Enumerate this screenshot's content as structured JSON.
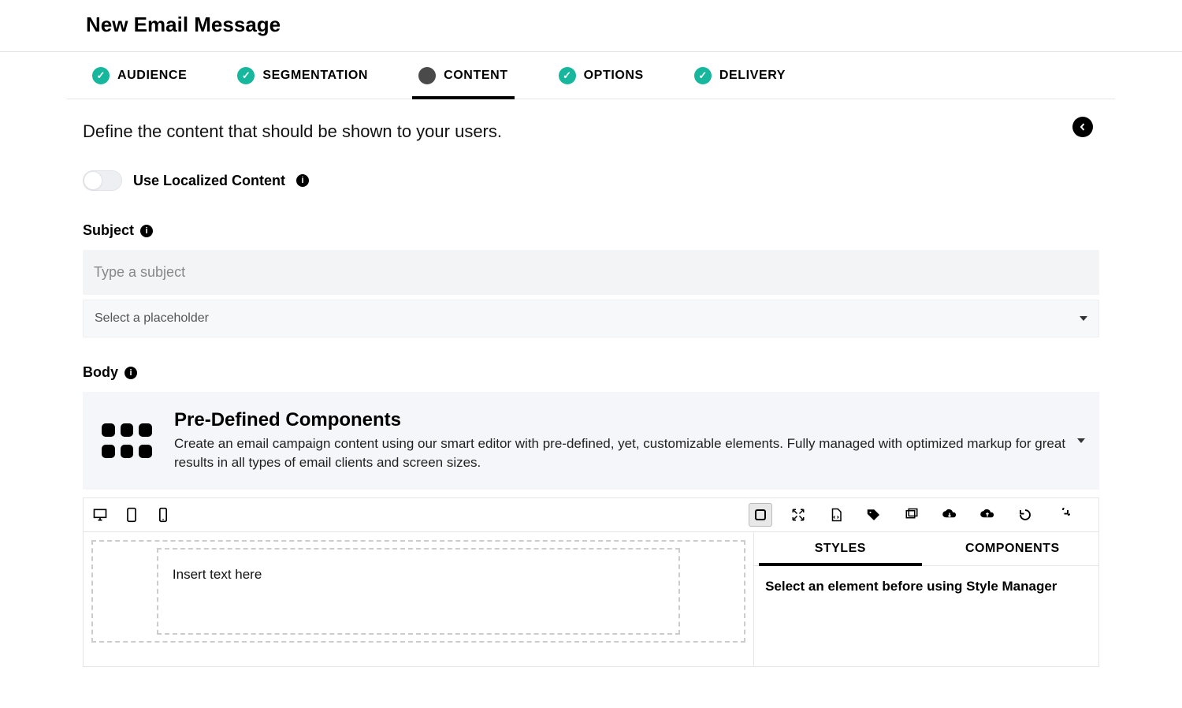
{
  "page_title": "New Email Message",
  "steps": [
    {
      "label": "AUDIENCE",
      "state": "done"
    },
    {
      "label": "SEGMENTATION",
      "state": "done"
    },
    {
      "label": "CONTENT",
      "state": "active"
    },
    {
      "label": "OPTIONS",
      "state": "done"
    },
    {
      "label": "DELIVERY",
      "state": "done"
    }
  ],
  "intro_text": "Define the content that should be shown to your users.",
  "localized": {
    "label": "Use Localized Content",
    "enabled": false
  },
  "subject": {
    "label": "Subject",
    "value": "",
    "placeholder": "Type a subject",
    "select_placeholder": "Select a placeholder"
  },
  "body": {
    "label": "Body",
    "pdc": {
      "title": "Pre-Defined Components",
      "description": "Create an email campaign content using our smart editor with pre-defined, yet, customizable elements. Fully managed with optimized markup for great results in all types of email clients and screen sizes."
    },
    "side_tabs": {
      "styles": "STYLES",
      "components": "COMPONENTS",
      "active": "styles"
    },
    "side_msg": "Select an element before using Style Manager",
    "canvas_text": "Insert text here"
  }
}
